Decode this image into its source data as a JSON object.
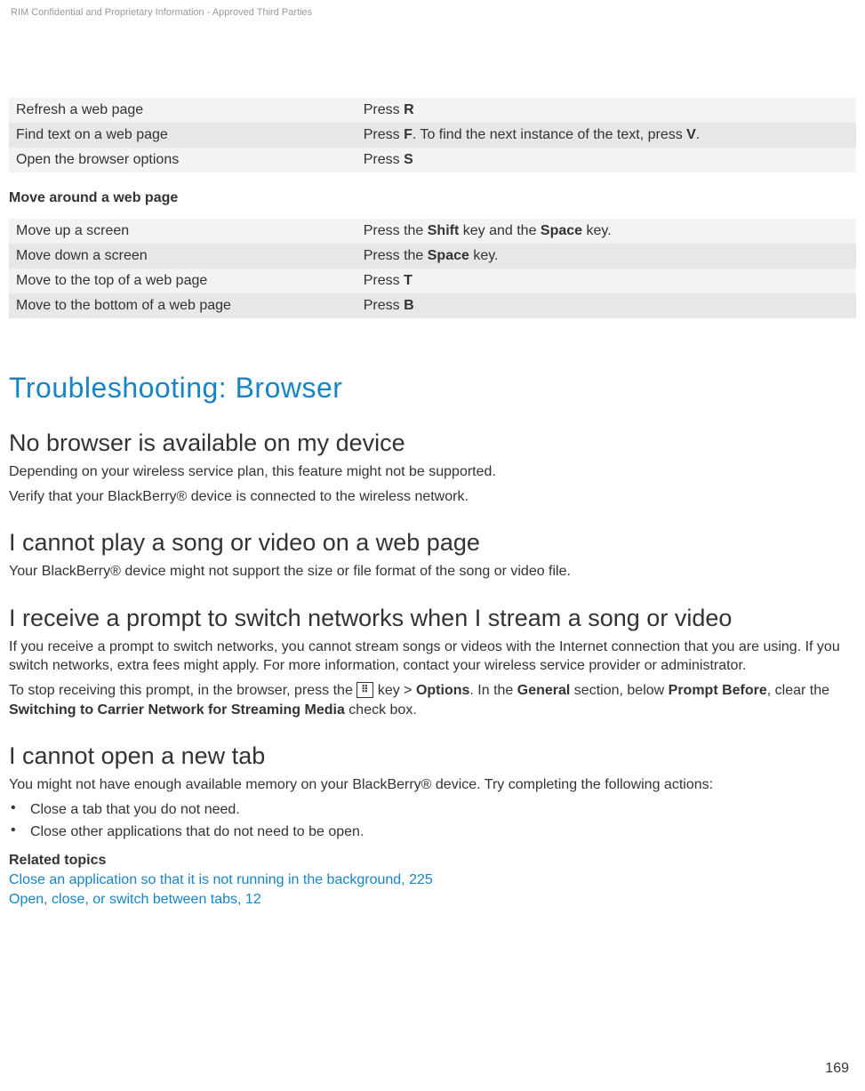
{
  "header_notice": "RIM Confidential and Proprietary Information - Approved Third Parties",
  "page_number": "169",
  "tables": {
    "browser_shortcuts": [
      {
        "action": "Refresh a web page",
        "shortcut_pre": "Press ",
        "key": "R",
        "shortcut_post": ""
      },
      {
        "action": "Find text on a web page",
        "shortcut_pre": "Press ",
        "key": "F",
        "shortcut_post": ". To find the next instance of the text, press ",
        "key2": "V",
        "shortcut_tail": "."
      },
      {
        "action": "Open the browser options",
        "shortcut_pre": "Press ",
        "key": "S",
        "shortcut_post": ""
      }
    ],
    "move_heading": "Move around a web page",
    "move_shortcuts": [
      {
        "action": "Move up a screen",
        "shortcut_pre": "Press the ",
        "key": "Shift",
        "shortcut_mid": " key and the ",
        "key2": "Space",
        "shortcut_tail": " key."
      },
      {
        "action": "Move down a screen",
        "shortcut_pre": "Press the ",
        "key": "Space",
        "shortcut_tail": " key."
      },
      {
        "action": "Move to the top of a web page",
        "shortcut_pre": "Press ",
        "key": "T"
      },
      {
        "action": "Move to the bottom of a web page",
        "shortcut_pre": "Press ",
        "key": "B"
      }
    ]
  },
  "h1": "Troubleshooting: Browser",
  "sections": {
    "no_browser": {
      "heading": "No browser is available on my device",
      "p1": "Depending on your wireless service plan, this feature might not be supported.",
      "p2": "Verify that your BlackBerry® device is connected to the wireless network."
    },
    "cannot_play": {
      "heading": "I cannot play a song or video on a web page",
      "p1": "Your BlackBerry® device might not support the size or file format of the song or video file."
    },
    "switch_networks": {
      "heading": "I receive a prompt to switch networks when I stream a song or video",
      "p1": "If you receive a prompt to switch networks, you cannot stream songs or videos with the Internet connection that you are using. If you switch networks, extra fees might apply. For more information, contact your wireless service provider or administrator.",
      "p2_pre": "To stop receiving this prompt, in the browser, press the ",
      "p2_key_after": " key > ",
      "p2_b1": "Options",
      "p2_mid": ". In the ",
      "p2_b2": "General",
      "p2_mid2": " section, below ",
      "p2_b3": "Prompt Before",
      "p2_mid3": ", clear the ",
      "p2_b4": "Switching to Carrier Network for Streaming Media",
      "p2_tail": " check box."
    },
    "new_tab": {
      "heading": "I cannot open a new tab",
      "p1": "You might not have enough available memory on your BlackBerry® device. Try completing the following actions:",
      "bullets": [
        "Close a tab that you do not need.",
        "Close other applications that do not need to be open."
      ],
      "related_heading": "Related topics",
      "related_links": [
        "Close an application so that it is not running in the background, 225",
        "Open, close, or switch between tabs, 12"
      ]
    }
  }
}
